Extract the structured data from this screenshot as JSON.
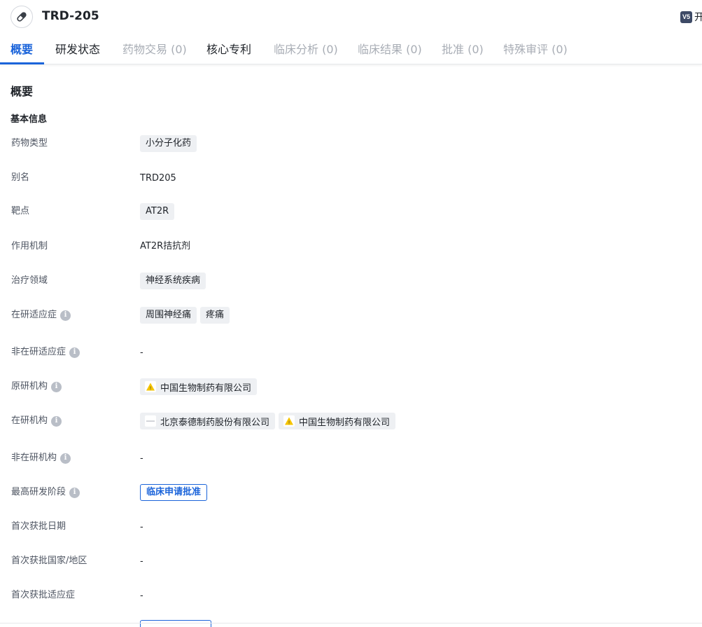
{
  "header": {
    "title": "TRD-205",
    "drug_icon": "pill-icon",
    "v5_badge": "V5",
    "v5_text": "开"
  },
  "tabs": [
    {
      "label": "概要",
      "state": "active"
    },
    {
      "label": "研发状态",
      "state": "normal"
    },
    {
      "label": "药物交易 (0)",
      "state": "disabled"
    },
    {
      "label": "核心专利",
      "state": "normal"
    },
    {
      "label": "临床分析 (0)",
      "state": "disabled"
    },
    {
      "label": "临床结果 (0)",
      "state": "disabled"
    },
    {
      "label": "批准 (0)",
      "state": "disabled"
    },
    {
      "label": "特殊审评 (0)",
      "state": "disabled"
    }
  ],
  "overview": {
    "section_title": "概要",
    "basic_info_title": "基本信息",
    "rows": {
      "drug_type": {
        "label": "药物类型",
        "tags": [
          "小分子化药"
        ]
      },
      "alias": {
        "label": "别名",
        "value": "TRD205"
      },
      "target": {
        "label": "靶点",
        "tags": [
          "AT2R"
        ]
      },
      "mechanism": {
        "label": "作用机制",
        "value": "AT2R拮抗剂"
      },
      "therapeutic_area": {
        "label": "治疗领域",
        "tags": [
          "神经系统疾病"
        ]
      },
      "active_indications": {
        "label": "在研适应症",
        "tags": [
          "周围神经痛",
          "疼痛"
        ]
      },
      "inactive_indications": {
        "label": "非在研适应症",
        "value": "-"
      },
      "originator": {
        "label": "原研机构",
        "orgs": [
          {
            "name": "中国生物制药有限公司",
            "logo": "warning-triangle-logo-icon"
          }
        ]
      },
      "active_orgs": {
        "label": "在研机构",
        "orgs": [
          {
            "name": "北京泰德制药股份有限公司",
            "logo": "dash-logo-icon"
          },
          {
            "name": "中国生物制药有限公司",
            "logo": "warning-triangle-logo-icon"
          }
        ]
      },
      "inactive_orgs": {
        "label": "非在研机构",
        "value": "-"
      },
      "highest_phase": {
        "label": "最高研发阶段",
        "value": "临床申请批准"
      },
      "first_approval_date": {
        "label": "首次获批日期",
        "value": "-"
      },
      "first_approval_country": {
        "label": "首次获批国家/地区",
        "value": "-"
      },
      "first_approval_indication": {
        "label": "首次获批适应症",
        "value": "-"
      }
    }
  },
  "colors": {
    "accent": "#1b64da",
    "tag_bg": "#eef0f3",
    "disabled_text": "#a8adb5",
    "badge_bg": "#3d4a66"
  }
}
